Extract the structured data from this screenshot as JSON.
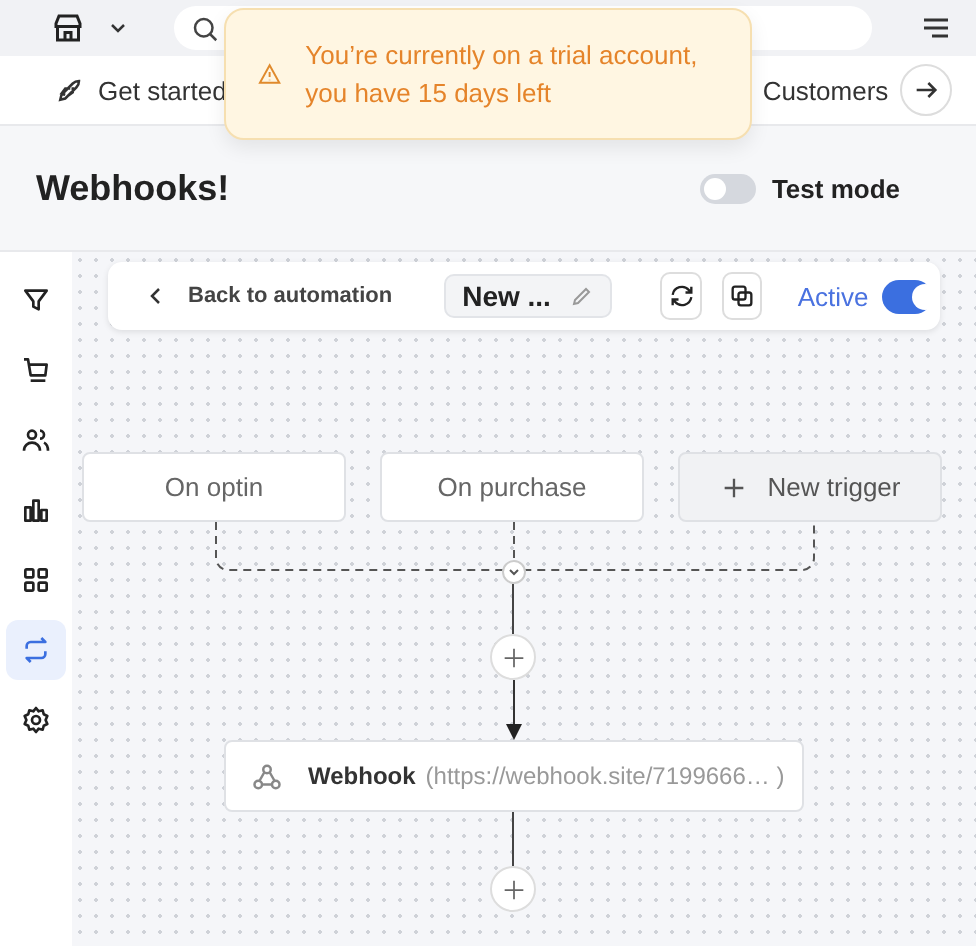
{
  "toast": {
    "message": "You’re currently on a trial account, you have 15 days left"
  },
  "nav_tabs": [
    {
      "label": "Get started",
      "kind": "rocket"
    },
    {
      "label": "Customers",
      "kind": "plain"
    }
  ],
  "page": {
    "title": "Webhooks!",
    "test_mode": {
      "label": "Test mode",
      "on": false
    }
  },
  "sidebar": {
    "items": [
      {
        "selected": false
      },
      {
        "selected": false
      },
      {
        "selected": false
      },
      {
        "selected": false
      },
      {
        "selected": false
      },
      {
        "selected": true
      },
      {
        "selected": false
      }
    ]
  },
  "toolbar": {
    "back": "Back to automation",
    "name": "New ...",
    "active": {
      "label": "Active",
      "on": true
    }
  },
  "triggers": [
    {
      "label": "On optin",
      "kind": "trigger"
    },
    {
      "label": "On purchase",
      "kind": "trigger"
    },
    {
      "label": "New trigger",
      "kind": "add"
    }
  ],
  "step": {
    "title": "Webhook",
    "detail": "(https://webhook.site/7199666… )"
  }
}
